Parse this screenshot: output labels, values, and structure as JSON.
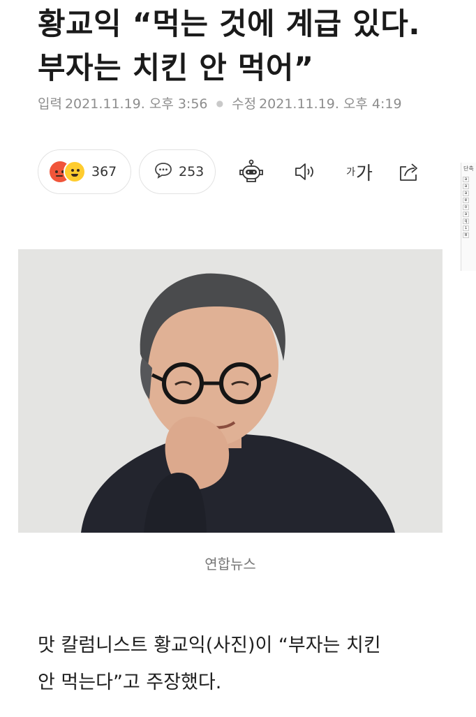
{
  "article": {
    "headline_line1": "황교익 “먹는 것에 계급 있다.",
    "headline_line2": "부자는 치킨 안 먹어”",
    "published_label": "입력",
    "published_time": "2021.11.19. 오후 3:56",
    "modified_label": "수정",
    "modified_time": "2021.11.19. 오후 4:19",
    "photo_caption": "연합뉴스",
    "body_line1": "맛 칼럼니스트 황교익(사진)이 “부자는 치킨",
    "body_line2": "안 먹는다”고 주장했다."
  },
  "toolbar": {
    "reaction_count": "367",
    "comment_count": "253",
    "font_size_small": "가",
    "font_size_large": "가"
  },
  "side_panel": {
    "header": "단축",
    "rows": [
      "a",
      "a",
      "a",
      "e",
      "o",
      "a",
      "q",
      "1",
      "8"
    ]
  },
  "icons": {
    "reactions": [
      "angry-face-icon",
      "smile-face-icon"
    ],
    "comment": "speech-bubble-icon",
    "summary": "robot-icon",
    "tts": "speaker-icon",
    "font_size": "font-size-icon",
    "share": "share-icon"
  },
  "colors": {
    "angry": "#f0553a",
    "happy": "#ffcc2e",
    "meta_text": "#8d8d8d",
    "pill_border": "#e2e2e2"
  }
}
